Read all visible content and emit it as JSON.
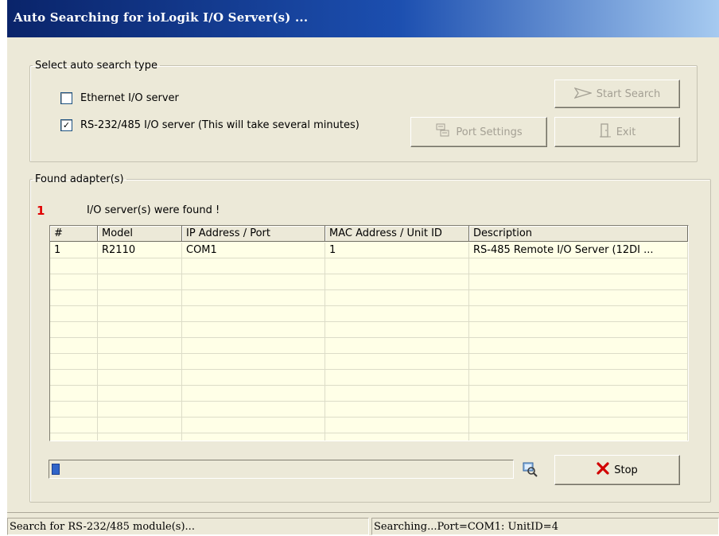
{
  "window": {
    "title": "Auto Searching for ioLogik I/O Server(s) ..."
  },
  "search_type": {
    "legend": "Select auto search type",
    "ethernet": {
      "label": "Ethernet I/O server",
      "checked": false
    },
    "serial": {
      "label": "RS-232/485 I/O server (This will take several minutes)",
      "checked": true
    },
    "buttons": {
      "start": "Start Search",
      "port_settings": "Port Settings",
      "exit": "Exit"
    }
  },
  "found": {
    "legend": "Found adapter(s)",
    "count": "1",
    "message": "I/O server(s) were found !",
    "columns": [
      "#",
      "Model",
      "IP Address / Port",
      "MAC Address / Unit ID",
      "Description"
    ],
    "rows": [
      [
        "1",
        "R2110",
        "COM1",
        "1",
        "RS-485 Remote I/O Server (12DI ..."
      ]
    ],
    "progress": 0.015,
    "stop_label": "Stop"
  },
  "icons": {
    "start": "arrow-send-icon",
    "port": "ports-icon",
    "exit": "door-icon",
    "search": "magnifier-computer-icon",
    "stop": "red-x-icon"
  },
  "status": {
    "left": "Search for RS-232/485 module(s)...",
    "right": "Searching...Port=COM1: UnitID=4"
  }
}
